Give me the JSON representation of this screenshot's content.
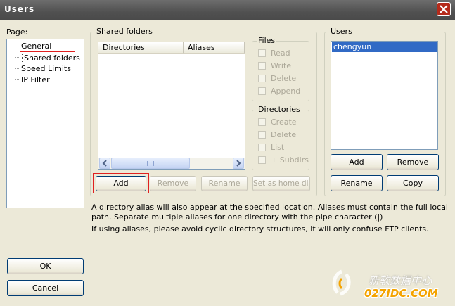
{
  "window": {
    "title": "Users"
  },
  "page_panel": {
    "label": "Page:",
    "items": [
      {
        "label": "General"
      },
      {
        "label": "Shared folders"
      },
      {
        "label": "Speed Limits"
      },
      {
        "label": "IP Filter"
      }
    ],
    "selected": "Shared folders"
  },
  "shared_folders": {
    "group_label": "Shared folders",
    "columns": [
      "Directories",
      "Aliases"
    ],
    "buttons": {
      "add": "Add",
      "remove": "Remove",
      "rename": "Rename",
      "set_home": "Set as home dir"
    }
  },
  "files_group": {
    "label": "Files",
    "options": [
      "Read",
      "Write",
      "Delete",
      "Append"
    ]
  },
  "directories_group": {
    "label": "Directories",
    "options": [
      "Create",
      "Delete",
      "List",
      "+ Subdirs"
    ]
  },
  "users_panel": {
    "label": "Users",
    "items": [
      "chengyun"
    ],
    "buttons": {
      "add": "Add",
      "remove": "Remove",
      "rename": "Rename",
      "copy": "Copy"
    }
  },
  "info": {
    "line1": "A directory alias will also appear at the specified location. Aliases must contain the full local",
    "line2": "path. Separate multiple aliases for one directory with the pipe character (|)",
    "line3": "If using aliases, please avoid cyclic directory structures, it will only confuse FTP clients."
  },
  "dialog_buttons": {
    "ok": "OK",
    "cancel": "Cancel"
  },
  "watermark": {
    "text1": "新软数据中心",
    "text2": "027IDC.COM"
  },
  "colors": {
    "title_bar": "#515151",
    "selection": "#316ac5",
    "highlight_box": "#e02020",
    "watermark": "#f4a300"
  }
}
